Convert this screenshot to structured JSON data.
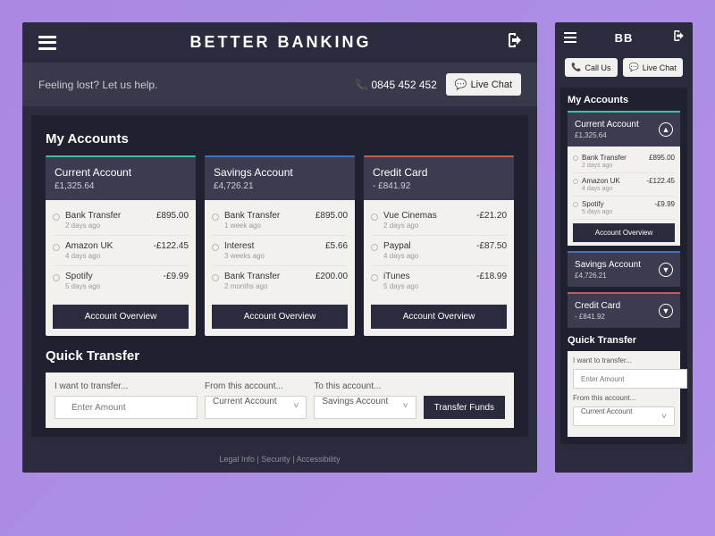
{
  "header": {
    "title": "BETTER BANKING"
  },
  "help": {
    "text": "Feeling lost? Let us help.",
    "phone": "0845 452 452",
    "chat": "Live Chat"
  },
  "sections": {
    "accounts": "My Accounts",
    "transfer": "Quick Transfer"
  },
  "accounts": [
    {
      "name": "Current Account",
      "balance": "£1,325.64",
      "accent": "green",
      "txns": [
        {
          "name": "Bank Transfer",
          "time": "2 days ago",
          "amt": "£895.00"
        },
        {
          "name": "Amazon UK",
          "time": "4 days ago",
          "amt": "-£122.45"
        },
        {
          "name": "Spotify",
          "time": "5 days ago",
          "amt": "-£9.99"
        }
      ]
    },
    {
      "name": "Savings Account",
      "balance": "£4,726.21",
      "accent": "blue",
      "txns": [
        {
          "name": "Bank Transfer",
          "time": "1 week ago",
          "amt": "£895.00"
        },
        {
          "name": "Interest",
          "time": "3 weeks ago",
          "amt": "£5.66"
        },
        {
          "name": "Bank Transfer",
          "time": "2 months ago",
          "amt": "£200.00"
        }
      ]
    },
    {
      "name": "Credit Card",
      "balance": "- £841.92",
      "accent": "red",
      "txns": [
        {
          "name": "Vue Cinemas",
          "time": "2 days ago",
          "amt": "-£21.20"
        },
        {
          "name": "Paypal",
          "time": "4 days ago",
          "amt": "-£87.50"
        },
        {
          "name": "iTunes",
          "time": "5 days ago",
          "amt": "-£18.99"
        }
      ]
    }
  ],
  "overview_btn": "Account Overview",
  "transfer": {
    "labels": {
      "amount": "I want to transfer...",
      "from": "From this account...",
      "to": "To this account..."
    },
    "placeholder": "Enter Amount",
    "currency": "£",
    "from": "Current Account",
    "to": "Savings Account",
    "button": "Transfer Funds"
  },
  "footer": {
    "legal": "Legal Info",
    "security": "Security",
    "accessibility": "Accessibility"
  },
  "mobile": {
    "title": "BB",
    "call": "Call Us",
    "chat": "Live Chat"
  }
}
